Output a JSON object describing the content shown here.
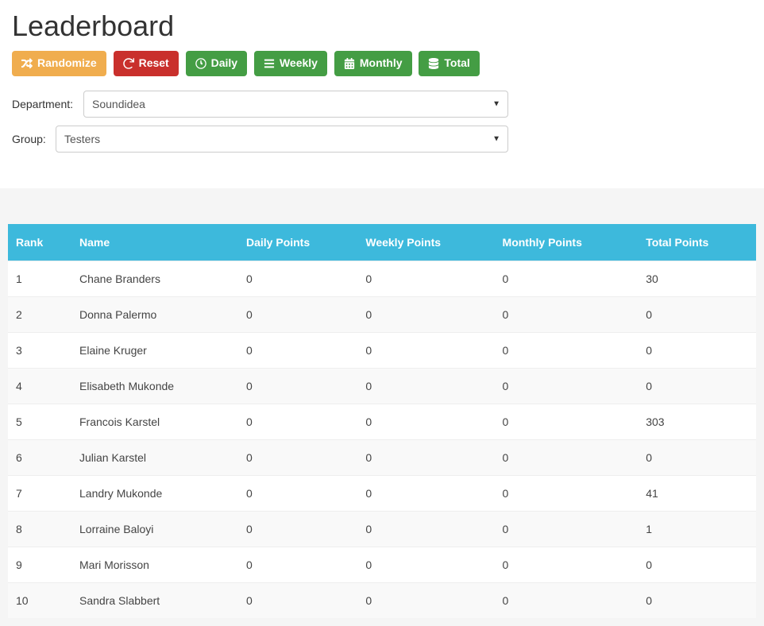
{
  "title": "Leaderboard",
  "buttons": {
    "randomize": "Randomize",
    "reset": "Reset",
    "daily": "Daily",
    "weekly": "Weekly",
    "monthly": "Monthly",
    "total": "Total"
  },
  "filters": {
    "department_label": "Department:",
    "department_value": "Soundidea",
    "group_label": "Group:",
    "group_value": "Testers"
  },
  "table": {
    "headers": {
      "rank": "Rank",
      "name": "Name",
      "daily": "Daily Points",
      "weekly": "Weekly Points",
      "monthly": "Monthly Points",
      "total": "Total Points"
    },
    "rows": [
      {
        "rank": "1",
        "name": "Chane Branders",
        "daily": "0",
        "weekly": "0",
        "monthly": "0",
        "total": "30"
      },
      {
        "rank": "2",
        "name": "Donna Palermo",
        "daily": "0",
        "weekly": "0",
        "monthly": "0",
        "total": "0"
      },
      {
        "rank": "3",
        "name": "Elaine Kruger",
        "daily": "0",
        "weekly": "0",
        "monthly": "0",
        "total": "0"
      },
      {
        "rank": "4",
        "name": "Elisabeth Mukonde",
        "daily": "0",
        "weekly": "0",
        "monthly": "0",
        "total": "0"
      },
      {
        "rank": "5",
        "name": "Francois Karstel",
        "daily": "0",
        "weekly": "0",
        "monthly": "0",
        "total": "303"
      },
      {
        "rank": "6",
        "name": "Julian Karstel",
        "daily": "0",
        "weekly": "0",
        "monthly": "0",
        "total": "0"
      },
      {
        "rank": "7",
        "name": "Landry Mukonde",
        "daily": "0",
        "weekly": "0",
        "monthly": "0",
        "total": "41"
      },
      {
        "rank": "8",
        "name": "Lorraine Baloyi",
        "daily": "0",
        "weekly": "0",
        "monthly": "0",
        "total": "1"
      },
      {
        "rank": "9",
        "name": "Mari Morisson",
        "daily": "0",
        "weekly": "0",
        "monthly": "0",
        "total": "0"
      },
      {
        "rank": "10",
        "name": "Sandra Slabbert",
        "daily": "0",
        "weekly": "0",
        "monthly": "0",
        "total": "0"
      }
    ]
  }
}
